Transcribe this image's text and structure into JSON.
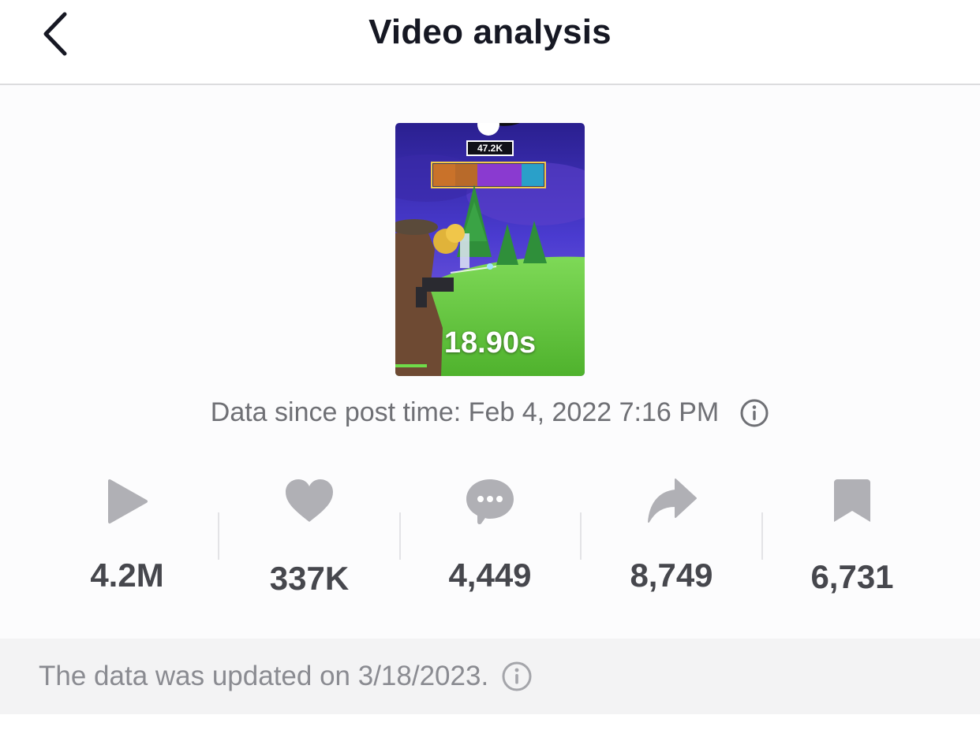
{
  "header": {
    "title": "Video analysis",
    "back_icon": "chevron-left-icon"
  },
  "video": {
    "duration": "18.90s",
    "hud_count": "47.2K"
  },
  "post_info": {
    "text": "Data since post time: Feb 4, 2022 7:16 PM",
    "icon": "info-icon"
  },
  "stats": [
    {
      "icon": "play-icon",
      "value": "4.2M"
    },
    {
      "icon": "heart-icon",
      "value": "337K"
    },
    {
      "icon": "comment-icon",
      "value": "4,449"
    },
    {
      "icon": "share-icon",
      "value": "8,749"
    },
    {
      "icon": "bookmark-icon",
      "value": "6,731"
    }
  ],
  "footer": {
    "text": "The data was updated on 3/18/2023.",
    "icon": "info-icon"
  },
  "colors": {
    "icon_gray": "#b0b0b5",
    "value_gray": "#46474d",
    "text_gray": "#6f7075",
    "footer_bg": "#f3f3f4"
  }
}
